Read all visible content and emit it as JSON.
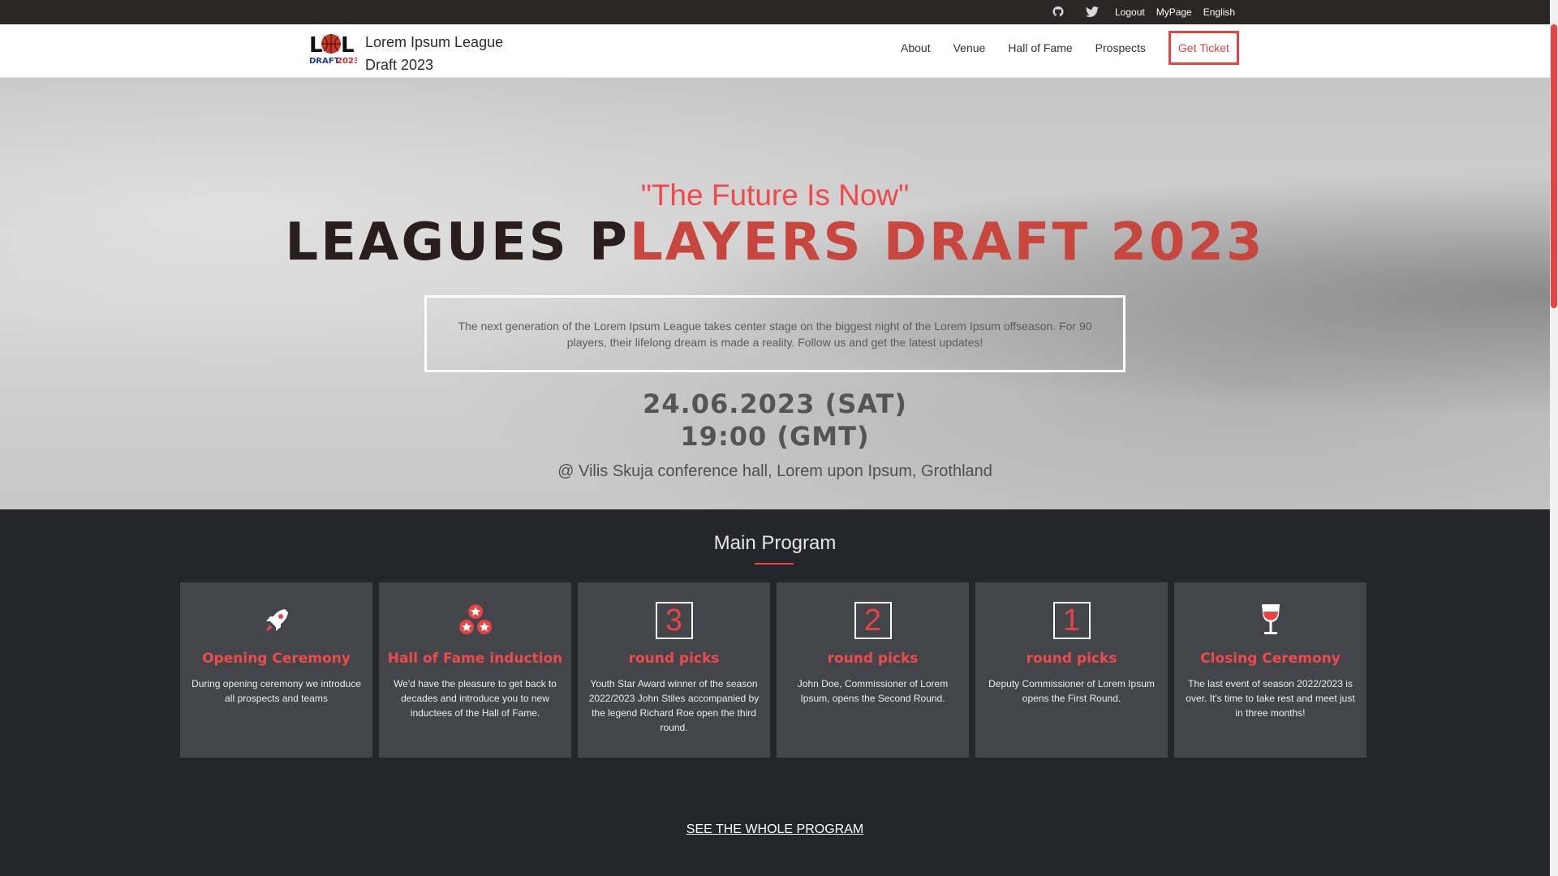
{
  "topbar": {
    "icons": [
      "github-icon",
      "twitter-icon"
    ],
    "links": [
      "Logout",
      "MyPage",
      "English"
    ]
  },
  "header": {
    "brand_line1": "Lorem Ipsum League",
    "brand_line2": "Draft 2023",
    "nav": [
      "About",
      "Venue",
      "Hall of Fame",
      "Prospects"
    ],
    "cta": "Get Ticket"
  },
  "hero": {
    "tagline": "\"The Future Is Now\"",
    "headline_part1": "LEAGUES P",
    "headline_part2": "LAYERS DRAFT 2023",
    "intro": "The next generation of the Lorem Ipsum League takes center stage on the biggest night of the Lorem Ipsum offseason. For 90 players, their lifelong dream is made a reality. Follow us and get the latest updates!",
    "date": "24.06.2023 (SAT)",
    "time": "19:00 (GMT)",
    "venue": "@ Vilis Skuja conference hall, Lorem upon Ipsum, Grothland"
  },
  "program": {
    "title": "Main Program",
    "cards": [
      {
        "icon": "rocket-icon",
        "title": "Opening Ceremony",
        "text": "During opening ceremony we introduce all prospects and teams"
      },
      {
        "icon": "stars-icon",
        "title": "Hall of Fame induction",
        "text": "We'd have the pleasure to get back to decades and introduce you to new inductees of the Hall of Fame."
      },
      {
        "number": "3",
        "title": "round picks",
        "text": "Youth Star Award winner of the season 2022/2023 John Stiles accompanied by the legend Richard Roe open the third round."
      },
      {
        "number": "2",
        "title": "round picks",
        "text": "John Doe, Commissioner of Lorem Ipsum, opens the Second Round."
      },
      {
        "number": "1",
        "title": "round picks",
        "text": "Deputy Commissioner of Lorem Ipsum opens the First Round."
      },
      {
        "icon": "wine-glass-icon",
        "title": "Closing Ceremony",
        "text": "The last event of season 2022/2023 is over. It's time to take rest and meet just in three months!"
      }
    ],
    "see_all": "SEE THE WHOLE PROGRAM"
  },
  "colors": {
    "accent": "#e64345",
    "topbar": "#2a2626",
    "program_bg": "#24262c",
    "card_bg": "#43454a"
  }
}
